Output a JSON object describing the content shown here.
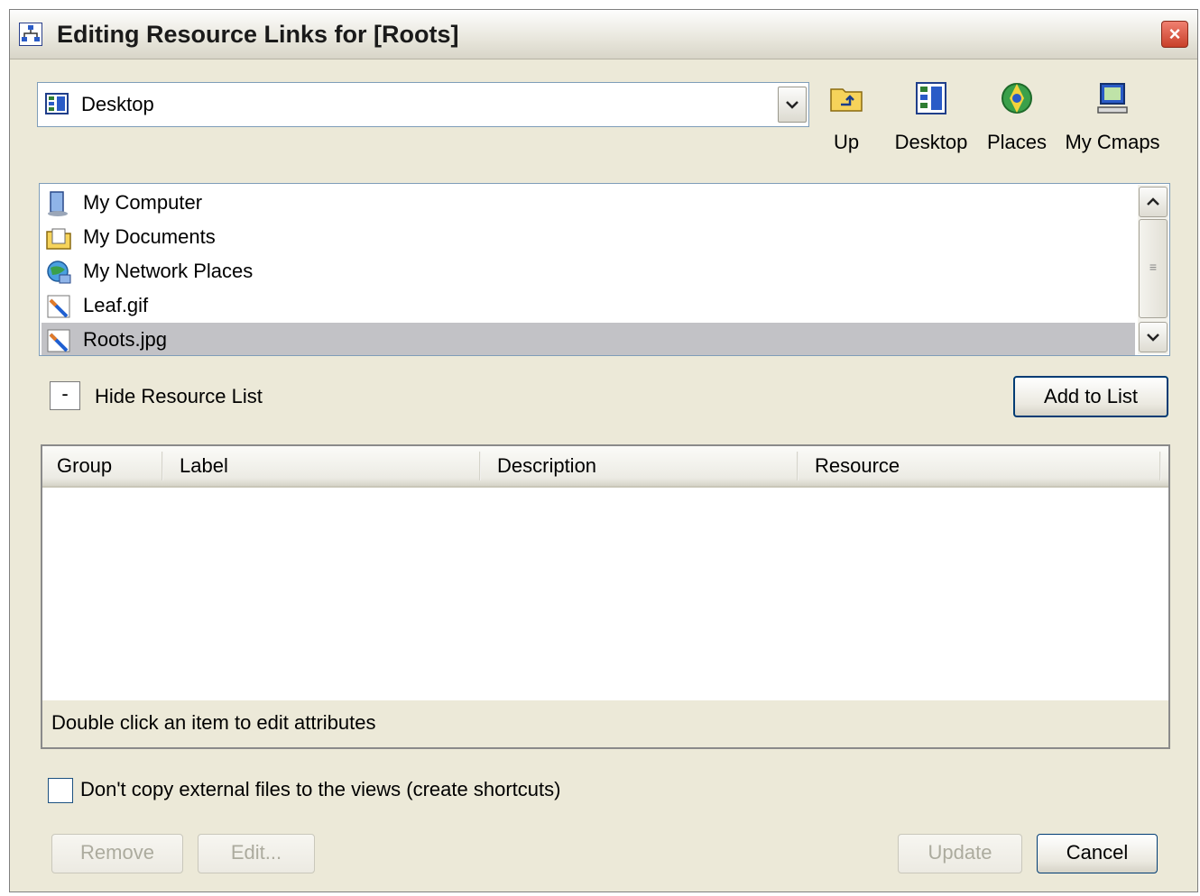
{
  "window": {
    "title": "Editing Resource Links for [Roots]",
    "close_glyph": "×"
  },
  "location": {
    "selected": "Desktop",
    "icon": "desktop-icon"
  },
  "toolbar": {
    "up_label": "Up",
    "desktop_label": "Desktop",
    "places_label": "Places",
    "mycmaps_label": "My Cmaps"
  },
  "files": [
    {
      "name": "My Computer",
      "icon": "computer-icon"
    },
    {
      "name": "My Documents",
      "icon": "documents-folder-icon"
    },
    {
      "name": "My Network Places",
      "icon": "network-icon"
    },
    {
      "name": "Leaf.gif",
      "icon": "image-file-icon"
    },
    {
      "name": "Roots.jpg",
      "icon": "image-file-icon",
      "selected": true
    }
  ],
  "resource_toggle": {
    "symbol": "-",
    "label": "Hide Resource List"
  },
  "add_to_list_label": "Add to List",
  "table": {
    "columns": [
      "Group",
      "Label",
      "Description",
      "Resource"
    ],
    "rows": [],
    "status": "Double click an item to edit attributes"
  },
  "no_copy_checkbox": {
    "label": "Don't copy external files to the views (create shortcuts)",
    "checked": false
  },
  "buttons": {
    "remove": "Remove",
    "edit": "Edit...",
    "update": "Update",
    "cancel": "Cancel"
  },
  "colors": {
    "dialog_bg": "#ece9d8",
    "selection": "#c2c2c6",
    "button_border": "#003c74"
  }
}
